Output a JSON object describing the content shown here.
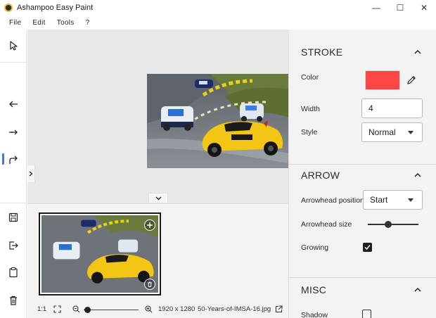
{
  "window": {
    "title": "Ashampoo Easy Paint",
    "controls": {
      "minimize": "—",
      "maximize": "☐",
      "close": "✕"
    }
  },
  "menu": {
    "items": [
      "File",
      "Edit",
      "Tools",
      "?"
    ]
  },
  "toolbar": {
    "items": [
      {
        "name": "select-icon"
      },
      {
        "name": "arrow-left-icon"
      },
      {
        "name": "arrow-tool-icon",
        "active": true
      },
      {
        "name": "redo-arrow-icon"
      },
      {
        "name": "save-icon"
      },
      {
        "name": "export-icon"
      },
      {
        "name": "clipboard-icon"
      },
      {
        "name": "trash-icon"
      }
    ]
  },
  "status": {
    "ratio": "1:1",
    "dimensions": "1920 x 1280",
    "filename": "50-Years-of-IMSA-16.jpg"
  },
  "panel": {
    "stroke": {
      "title": "STROKE",
      "color_label": "Color",
      "color_value": "#ff4646",
      "width_label": "Width",
      "width_value": "4",
      "style_label": "Style",
      "style_value": "Normal"
    },
    "arrow": {
      "title": "ARROW",
      "position_label": "Arrowhead position",
      "position_value": "Start",
      "size_label": "Arrowhead size",
      "size_fraction": 0.33,
      "growing_label": "Growing",
      "growing_checked": true
    },
    "misc": {
      "title": "MISC",
      "shadow_label": "Shadow",
      "shadow_checked": false
    }
  }
}
